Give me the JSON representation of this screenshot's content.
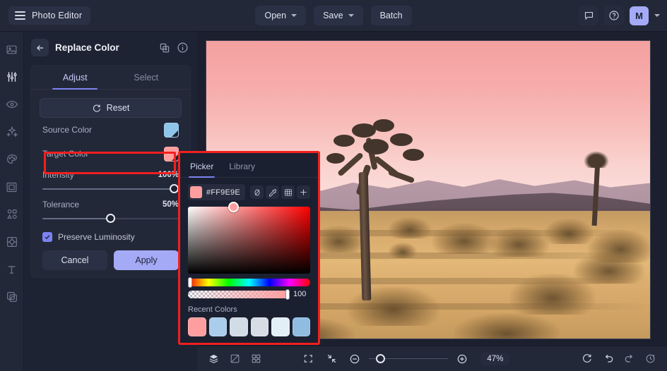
{
  "app": {
    "title": "Photo Editor",
    "menu_icon": "hamburger-icon"
  },
  "topbar": {
    "open_label": "Open",
    "save_label": "Save",
    "batch_label": "Batch",
    "feedback_icon": "comment-icon",
    "help_icon": "help-circle-icon",
    "avatar_initial": "M",
    "avatar_color": "#a5aaf7"
  },
  "rail": {
    "items": [
      {
        "icon": "image-icon",
        "active": false
      },
      {
        "icon": "adjustments-icon",
        "active": true
      },
      {
        "icon": "eye-icon",
        "active": false
      },
      {
        "icon": "sparkles-icon",
        "active": false
      },
      {
        "icon": "palette-icon",
        "active": false
      },
      {
        "icon": "frame-icon",
        "active": false
      },
      {
        "icon": "shapes-icon",
        "active": false
      },
      {
        "icon": "filter-transform-icon",
        "active": false
      },
      {
        "icon": "text-icon",
        "active": false
      },
      {
        "icon": "layers-copy-icon",
        "active": false
      }
    ]
  },
  "panel": {
    "back_icon": "arrow-left-icon",
    "title": "Replace Color",
    "duplicate_icon": "duplicate-icon",
    "info_icon": "info-icon",
    "tabs": [
      {
        "label": "Adjust",
        "active": true
      },
      {
        "label": "Select",
        "active": false
      }
    ],
    "reset_label": "Reset",
    "reset_icon": "refresh-icon",
    "source_color": {
      "label": "Source Color",
      "value": "#8EC5E8"
    },
    "target_color": {
      "label": "Target Color",
      "value": "#FF9E9E",
      "highlighted": true
    },
    "intensity": {
      "label": "Intensity",
      "value": "100%",
      "percent": 100
    },
    "tolerance": {
      "label": "Tolerance",
      "value": "50%",
      "percent": 50
    },
    "preserve_luminosity": {
      "label": "Preserve Luminosity",
      "checked": true
    },
    "cancel_label": "Cancel",
    "apply_label": "Apply",
    "highlight_color": "#f21f1f"
  },
  "picker": {
    "tabs": [
      {
        "label": "Picker",
        "active": true
      },
      {
        "label": "Library",
        "active": false
      }
    ],
    "hex_value": "#FF9E9E",
    "swatch_color": "#FF9E9E",
    "tools": [
      {
        "icon": "no-color-icon"
      },
      {
        "icon": "eyedropper-icon"
      },
      {
        "icon": "palette-grid-icon"
      },
      {
        "icon": "plus-icon"
      }
    ],
    "saturation_marker": {
      "x_percent": 37,
      "y_percent": 0
    },
    "hue_position_percent": 0,
    "alpha_value": "100",
    "alpha_percent": 100,
    "recent_colors_label": "Recent Colors",
    "recent_colors": [
      "#FF9E9E",
      "#A9CDEA",
      "#D2DCE6",
      "#D6DDE5",
      "#E2EFF7",
      "#8FBCE0"
    ],
    "highlight_color": "#f21f1f"
  },
  "bottombar": {
    "left_tools": [
      {
        "icon": "layers-icon"
      },
      {
        "icon": "compare-icon"
      },
      {
        "icon": "grid-icon"
      }
    ],
    "fit_icon": "fit-screen-icon",
    "shrink_icon": "shrink-icon",
    "zoom_out_icon": "zoom-out-icon",
    "zoom_in_icon": "zoom-in-icon",
    "zoom_value": "47%",
    "zoom_percent": 10,
    "right_tools": [
      {
        "icon": "rotate-icon"
      },
      {
        "icon": "undo-icon"
      },
      {
        "icon": "redo-icon"
      },
      {
        "icon": "history-icon"
      }
    ]
  },
  "canvas": {
    "image_description": "Desert landscape with Joshua tree under pink sky"
  }
}
